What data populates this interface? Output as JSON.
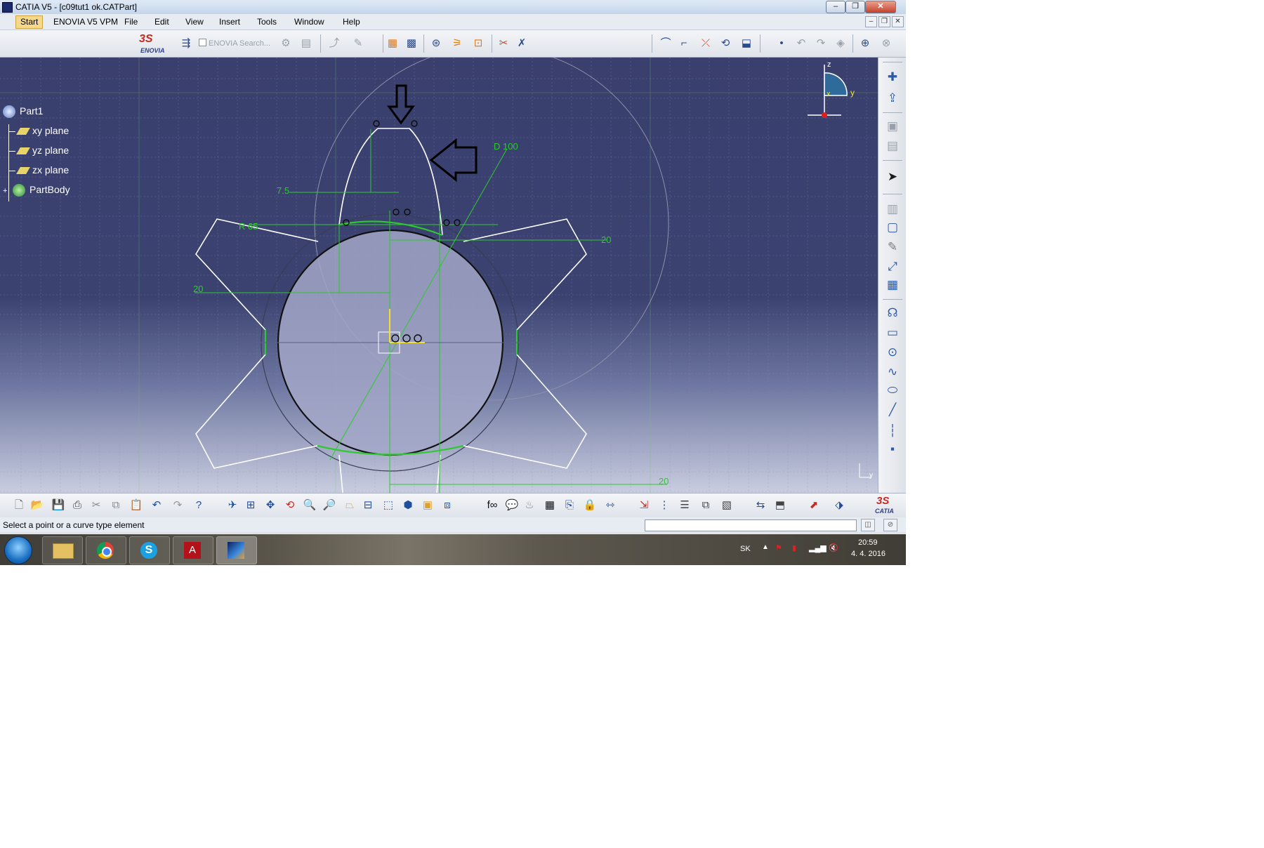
{
  "window": {
    "title": "CATIA V5 - [c09tut1 ok.CATPart]",
    "minimize": "–",
    "restore": "❐",
    "close": "✕"
  },
  "menu": {
    "items": [
      "Start",
      "ENOVIA V5 VPM",
      "File",
      "Edit",
      "View",
      "Insert",
      "Tools",
      "Window",
      "Help"
    ],
    "mdi_minimize": "–",
    "mdi_restore": "❐",
    "mdi_close": "✕"
  },
  "toolbar": {
    "enovia_logo_text": "ENOVIA",
    "ds_logo_text": "3S",
    "search_placeholder": "ENOVIA Search..."
  },
  "tree": {
    "root": "Part1",
    "items": [
      "xy plane",
      "yz plane",
      "zx plane",
      "PartBody"
    ]
  },
  "sketch": {
    "dimensions": {
      "d100": "D 100",
      "r65": "R 65",
      "d7_5": "7.5",
      "d20_right": "20",
      "d20_left": "20",
      "d20_bottom": "20"
    },
    "compass": {
      "z": "z",
      "y": "y",
      "x": "x"
    },
    "corner_axis": "y"
  },
  "catia_logo": {
    "ds": "3S",
    "text": "CATIA"
  },
  "status": {
    "message": "Select a point or a curve type element",
    "cmd_value": ""
  },
  "taskbar": {
    "language": "SK",
    "time": "20:59",
    "date": "4. 4. 2016"
  },
  "colors": {
    "viewport_top": "#3a3f6e",
    "sketch_white": "#ffffff",
    "dimension_green": "#2ec92e",
    "highlight": "#f6d88a"
  }
}
